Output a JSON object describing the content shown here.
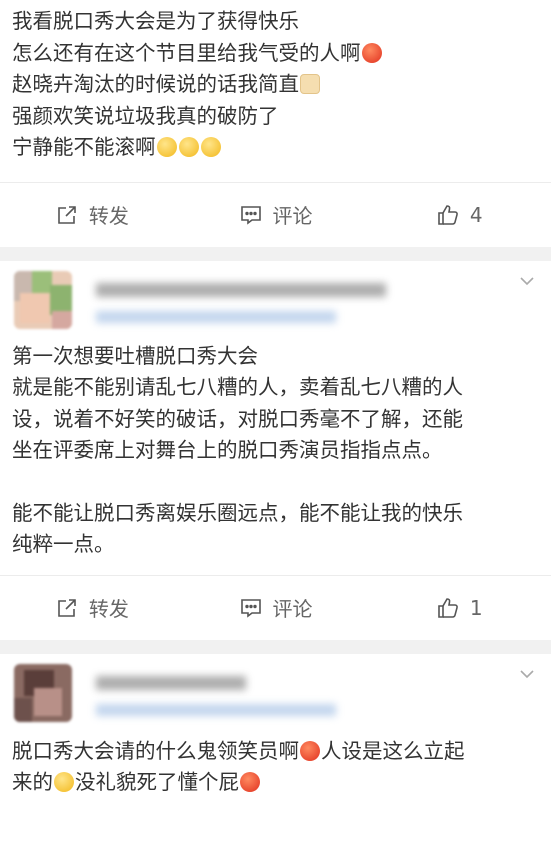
{
  "feed": {
    "posts": [
      {
        "lines": [
          "我看脱口秀大会是为了获得快乐",
          "怎么还有在这个节目里给我气受的人啊",
          "赵晓卉淘汰的时候说的话我简直",
          "强颜欢笑说垃圾我真的破防了",
          "宁静能不能滚啊"
        ],
        "emojis": [
          "angry",
          "dog",
          "smug"
        ],
        "repost_label": "转发",
        "comment_label": "评论",
        "like_count": "4"
      },
      {
        "lines": [
          "第一次想要吐槽脱口秀大会",
          "就是能不能别请乱七八糟的人，卖着乱七八糟的人",
          "设，说着不好笑的破话，对脱口秀毫不了解，还能",
          "坐在评委席上对舞台上的脱口秀演员指指点点。",
          "",
          "能不能让脱口秀离娱乐圈远点，能不能让我的快乐",
          "纯粹一点。"
        ],
        "repost_label": "转发",
        "comment_label": "评论",
        "like_count": "1"
      },
      {
        "parts": [
          "脱口秀大会请的什么鬼领笑员啊",
          "人设是这么立起",
          "来的",
          "没礼貌死了懂个屁"
        ],
        "emojis": [
          "angry",
          "smug",
          "angry"
        ]
      }
    ]
  },
  "icons": [
    "repost-icon",
    "comment-icon",
    "like-icon",
    "chevron-down-icon"
  ],
  "colors": {
    "text": "#333333",
    "action_text": "#666666",
    "separator": "#f1f1f1",
    "card": "#ffffff"
  }
}
